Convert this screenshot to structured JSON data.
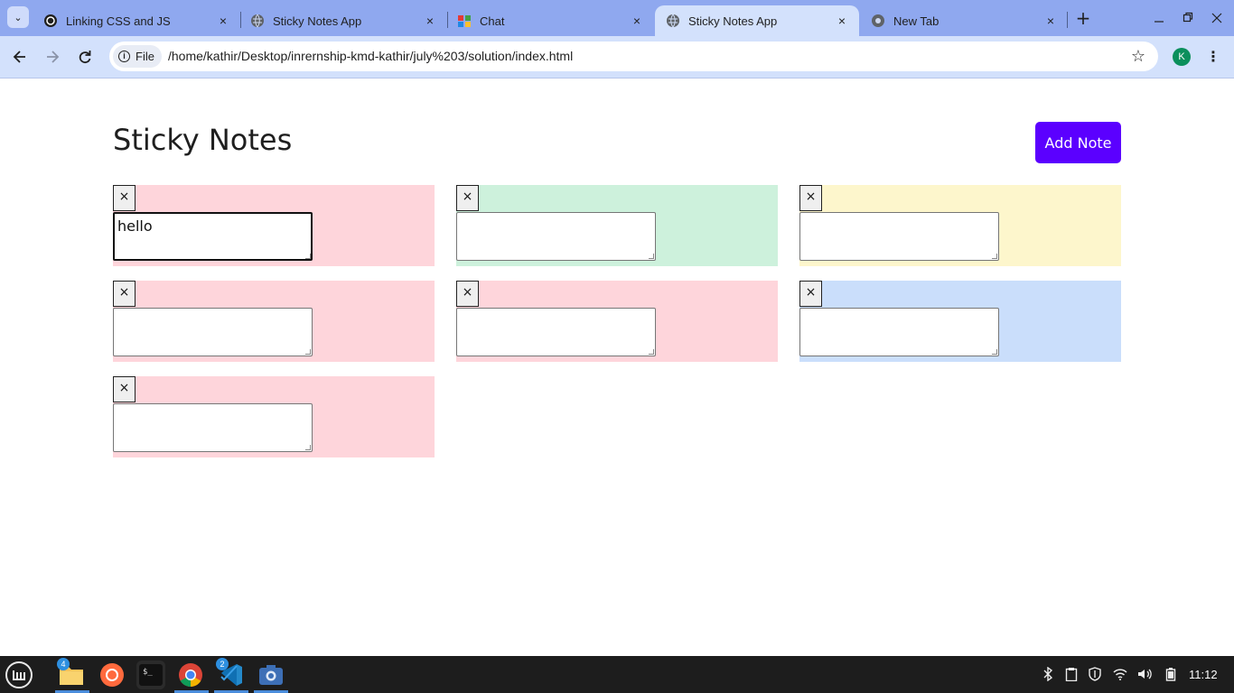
{
  "browser": {
    "tabs": [
      {
        "title": "Linking CSS and JS",
        "icon": "chatgpt-icon",
        "active": false
      },
      {
        "title": "Sticky Notes App",
        "icon": "globe-icon",
        "active": false
      },
      {
        "title": "Chat",
        "icon": "chat-app-icon",
        "active": false
      },
      {
        "title": "Sticky Notes App",
        "icon": "globe-icon",
        "active": true
      },
      {
        "title": "New Tab",
        "icon": "chrome-icon",
        "active": false
      }
    ],
    "site_chip": "File",
    "url": "/home/kathir/Desktop/inrernship-kmd-kathir/july%203/solution/index.html",
    "profile_initial": "K",
    "close_glyph": "×",
    "new_tab_glyph": "+"
  },
  "app": {
    "title": "Sticky Notes",
    "add_note_label": "Add Note",
    "delete_glyph": "×",
    "notes": [
      {
        "text": "hello",
        "color": "#fed5db",
        "focused": true
      },
      {
        "text": "",
        "color": "#cdf1dc",
        "focused": false
      },
      {
        "text": "",
        "color": "#fdf6cc",
        "focused": false
      },
      {
        "text": "",
        "color": "#fed5db",
        "focused": false
      },
      {
        "text": "",
        "color": "#fed5db",
        "focused": false
      },
      {
        "text": "",
        "color": "#cadefb",
        "focused": false
      },
      {
        "text": "",
        "color": "#fed5db",
        "focused": false
      }
    ],
    "accent_color": "#5b00ff"
  },
  "taskbar": {
    "apps": [
      {
        "name": "mint-menu-icon"
      },
      {
        "name": "files-icon",
        "badge": "4"
      },
      {
        "name": "firefox-icon"
      },
      {
        "name": "terminal-icon"
      },
      {
        "name": "chrome-icon",
        "active": true
      },
      {
        "name": "vscode-icon",
        "badge": "2"
      },
      {
        "name": "screenshot-icon"
      }
    ],
    "clock": "11:12"
  }
}
